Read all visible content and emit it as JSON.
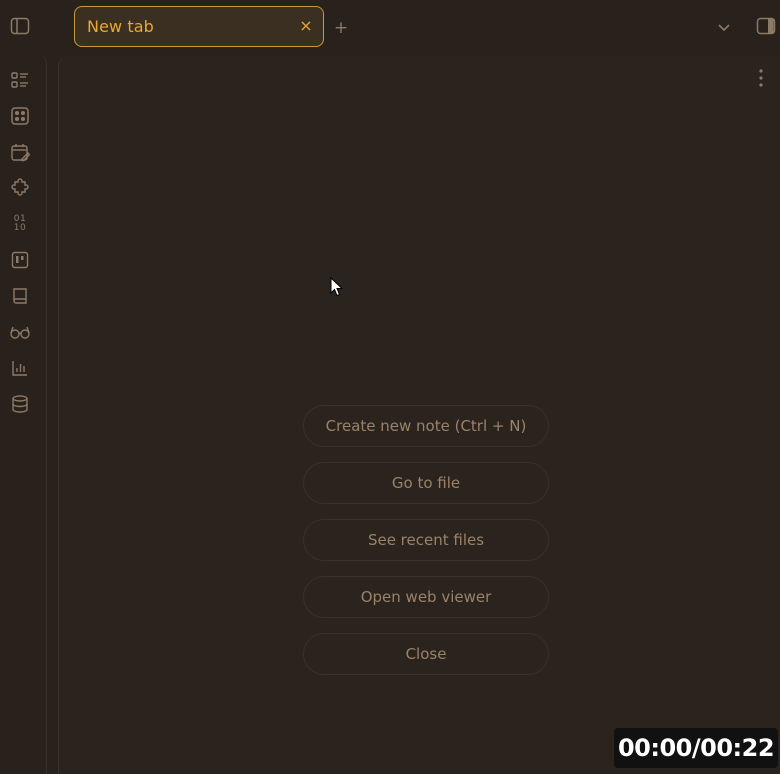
{
  "titlebar": {
    "left_sidebar_toggle_icon": "sidebar-left-icon",
    "tab": {
      "label": "New tab",
      "close_glyph": "×"
    },
    "new_tab_glyph": "+",
    "tab_list_icon": "chevron-down-icon",
    "right_sidebar_toggle_icon": "sidebar-right-icon"
  },
  "ribbon": {
    "items": [
      {
        "icon": "list-checks-icon"
      },
      {
        "icon": "dice-icon"
      },
      {
        "icon": "calendar-edit-icon"
      },
      {
        "icon": "puzzle-icon"
      },
      {
        "icon": "binary-icon",
        "text_top": "01",
        "text_bottom": "10"
      },
      {
        "icon": "kanban-icon"
      },
      {
        "icon": "book-icon"
      },
      {
        "icon": "glasses-icon"
      },
      {
        "icon": "bar-chart-icon"
      },
      {
        "icon": "database-icon"
      }
    ]
  },
  "pane": {
    "more_options_icon": "more-vertical-icon",
    "actions": [
      {
        "label": "Create new note (Ctrl + N)"
      },
      {
        "label": "Go to file"
      },
      {
        "label": "See recent files"
      },
      {
        "label": "Open web viewer"
      },
      {
        "label": "Close"
      }
    ]
  },
  "overlay": {
    "timer": "00:00/00:22"
  },
  "colors": {
    "background": "#29211c",
    "accent": "#e8a836",
    "tab_border": "#c89b3c",
    "muted_text": "#9a8368",
    "icon": "#8c7a68"
  }
}
